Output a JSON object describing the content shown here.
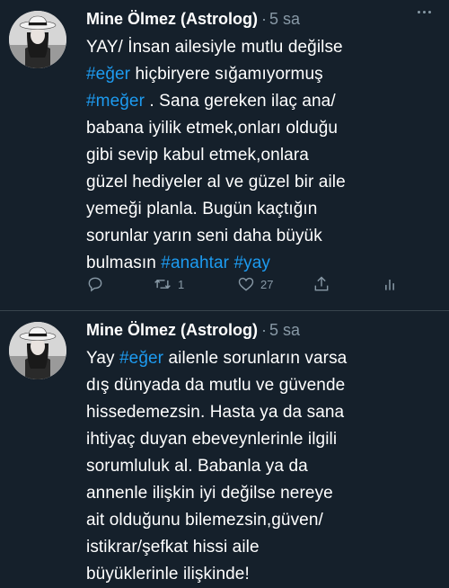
{
  "tweets": [
    {
      "author": "Mine Ölmez (Astrolog)",
      "separator": "·",
      "time": "5 sa",
      "lines": [
        [
          {
            "t": "YAY/ İnsan ailesiyle mutlu değilse",
            "h": false
          }
        ],
        [
          {
            "t": "#eğer",
            "h": true
          },
          {
            "t": " hiçbiryere sığamıyormuş",
            "h": false
          }
        ],
        [
          {
            "t": "#meğer",
            "h": true
          },
          {
            "t": " . Sana gereken ilaç ana/",
            "h": false
          }
        ],
        [
          {
            "t": "babana iyilik etmek,onları olduğu",
            "h": false
          }
        ],
        [
          {
            "t": "gibi sevip kabul etmek,onlara",
            "h": false
          }
        ],
        [
          {
            "t": "güzel hediyeler al ve güzel bir aile",
            "h": false
          }
        ],
        [
          {
            "t": "yemeği planla. Bugün kaçtığın",
            "h": false
          }
        ],
        [
          {
            "t": "sorunlar yarın seni daha büyük",
            "h": false
          }
        ],
        [
          {
            "t": "bulmasın ",
            "h": false
          },
          {
            "t": "#anahtar",
            "h": true
          },
          {
            "t": " ",
            "h": false
          },
          {
            "t": "#yay",
            "h": true
          }
        ]
      ],
      "retweets": "1",
      "likes": "27"
    },
    {
      "author": "Mine Ölmez (Astrolog)",
      "separator": "·",
      "time": "5 sa",
      "lines": [
        [
          {
            "t": "Yay ",
            "h": false
          },
          {
            "t": "#eğer",
            "h": true
          },
          {
            "t": " ailenle sorunların varsa",
            "h": false
          }
        ],
        [
          {
            "t": "dış dünyada da mutlu ve güvende",
            "h": false
          }
        ],
        [
          {
            "t": "hissedemezsin. Hasta ya da sana",
            "h": false
          }
        ],
        [
          {
            "t": "ihtiyaç duyan ebeveynlerinle ilgili",
            "h": false
          }
        ],
        [
          {
            "t": "sorumluluk al. Babanla ya da",
            "h": false
          }
        ],
        [
          {
            "t": "annenle ilişkin iyi değilse nereye",
            "h": false
          }
        ],
        [
          {
            "t": "ait olduğunu bilemezsin,güven/",
            "h": false
          }
        ],
        [
          {
            "t": "istikrar/şefkat hissi aile",
            "h": false
          }
        ],
        [
          {
            "t": "büyüklerinle ilişkinde!",
            "h": false
          }
        ]
      ]
    }
  ],
  "colors": {
    "background": "#15202b",
    "text": "#ffffff",
    "muted": "#8899a6",
    "hashtag": "#1d9bf0",
    "separator": "#38444d"
  },
  "icons": {
    "reply": "reply-icon",
    "retweet": "retweet-icon",
    "like": "heart-icon",
    "share": "share-icon",
    "analytics": "analytics-icon",
    "more": "more-icon"
  }
}
